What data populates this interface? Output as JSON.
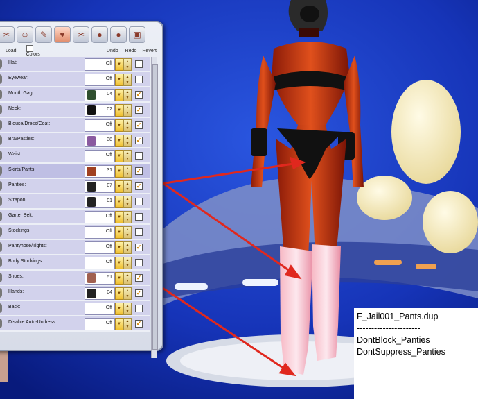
{
  "toolbar": {
    "icons": [
      "hair-icon",
      "figure-icon",
      "makeup-icon",
      "clothes-icon",
      "scissors-icon",
      "head-icon",
      "head-alt-icon",
      "picture-icon"
    ]
  },
  "subbar": {
    "load": "Load",
    "colors": "Colors",
    "undo": "Undo",
    "redo": "Redo",
    "revert": "Revert"
  },
  "rows": [
    {
      "label": "Hat:",
      "value": "Off",
      "checked": false
    },
    {
      "label": "Eyewear:",
      "value": "Off",
      "checked": false
    },
    {
      "label": "Mouth Gag:",
      "value": "04",
      "checked": true
    },
    {
      "label": "Neck:",
      "value": "02",
      "checked": true
    },
    {
      "label": "Blouse/Dress/Coat:",
      "value": "Off",
      "checked": true
    },
    {
      "label": "Bra/Pasties:",
      "value": "38",
      "checked": true
    },
    {
      "label": "Waist:",
      "value": "Off",
      "checked": false
    },
    {
      "label": "Skirts/Pants:",
      "value": "31",
      "checked": true
    },
    {
      "label": "Panties:",
      "value": "07",
      "checked": true
    },
    {
      "label": "Strapon:",
      "value": "01",
      "checked": false
    },
    {
      "label": "Garter Belt:",
      "value": "Off",
      "checked": false
    },
    {
      "label": "Stockings:",
      "value": "Off",
      "checked": false
    },
    {
      "label": "Pantyhose/Tights:",
      "value": "Off",
      "checked": true
    },
    {
      "label": "Body Stockings:",
      "value": "Off",
      "checked": false
    },
    {
      "label": "Shoes:",
      "value": "51",
      "checked": true
    },
    {
      "label": "Hands:",
      "value": "04",
      "checked": true
    },
    {
      "label": "Back:",
      "value": "Off",
      "checked": false
    },
    {
      "label": "Disable Auto-Undress:",
      "value": "Off",
      "checked": true
    }
  ],
  "note": {
    "line1": "F_Jail001_Pants.dup",
    "line2": "----------------------",
    "line3": "DontBlock_Panties",
    "line4": "DontSuppress_Panties"
  },
  "colors": {
    "arrow": "#e0281e",
    "background": "#0a1a7a",
    "checkmark": "#d08000"
  }
}
